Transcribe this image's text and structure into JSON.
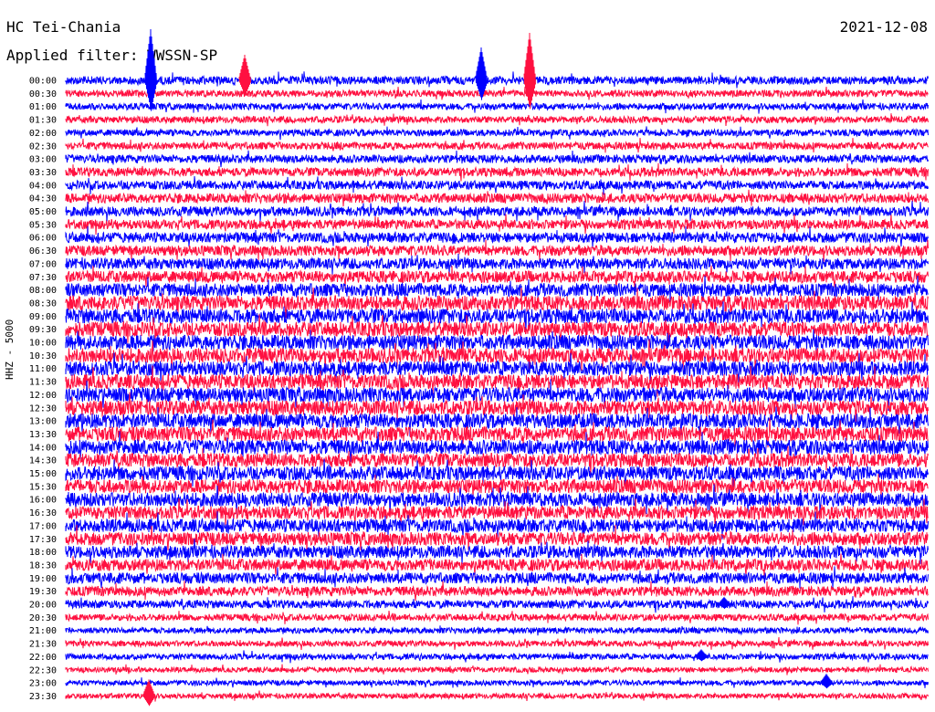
{
  "header": {
    "station": "HC Tei-Chania",
    "filter": "Applied filter: WWSSN-SP",
    "date": "2021-12-08"
  },
  "chart_data": {
    "type": "line",
    "title": "HC Tei-Chania",
    "subtitle": "Applied filter: WWSSN-SP",
    "date": "2021-12-08",
    "ylabel": "HHZ - 5000",
    "row_labels": [
      "00:00",
      "00:30",
      "01:00",
      "01:30",
      "02:00",
      "02:30",
      "03:00",
      "03:30",
      "04:00",
      "04:30",
      "05:00",
      "05:30",
      "06:00",
      "06:30",
      "07:00",
      "07:30",
      "08:00",
      "08:30",
      "09:00",
      "09:30",
      "10:00",
      "10:30",
      "11:00",
      "11:30",
      "12:00",
      "12:30",
      "13:00",
      "13:30",
      "14:00",
      "14:30",
      "15:00",
      "15:30",
      "16:00",
      "16:30",
      "17:00",
      "17:30",
      "18:00",
      "18:30",
      "19:00",
      "19:30",
      "20:00",
      "20:30",
      "21:00",
      "21:30",
      "22:00",
      "22:30",
      "23:00",
      "23:30"
    ],
    "row_colors": [
      "#0000ff",
      "#ff1040"
    ],
    "relative_amplitude": [
      0.55,
      0.45,
      0.45,
      0.45,
      0.45,
      0.5,
      0.55,
      0.6,
      0.6,
      0.65,
      0.65,
      0.65,
      0.7,
      0.7,
      0.75,
      0.8,
      0.9,
      1.0,
      1.0,
      1.0,
      1.0,
      1.0,
      1.0,
      1.0,
      1.0,
      1.0,
      1.0,
      1.0,
      1.0,
      0.95,
      0.95,
      0.95,
      0.95,
      0.9,
      0.9,
      0.9,
      0.85,
      0.8,
      0.75,
      0.65,
      0.55,
      0.45,
      0.4,
      0.4,
      0.4,
      0.35,
      0.35,
      0.35
    ],
    "grid": false
  }
}
